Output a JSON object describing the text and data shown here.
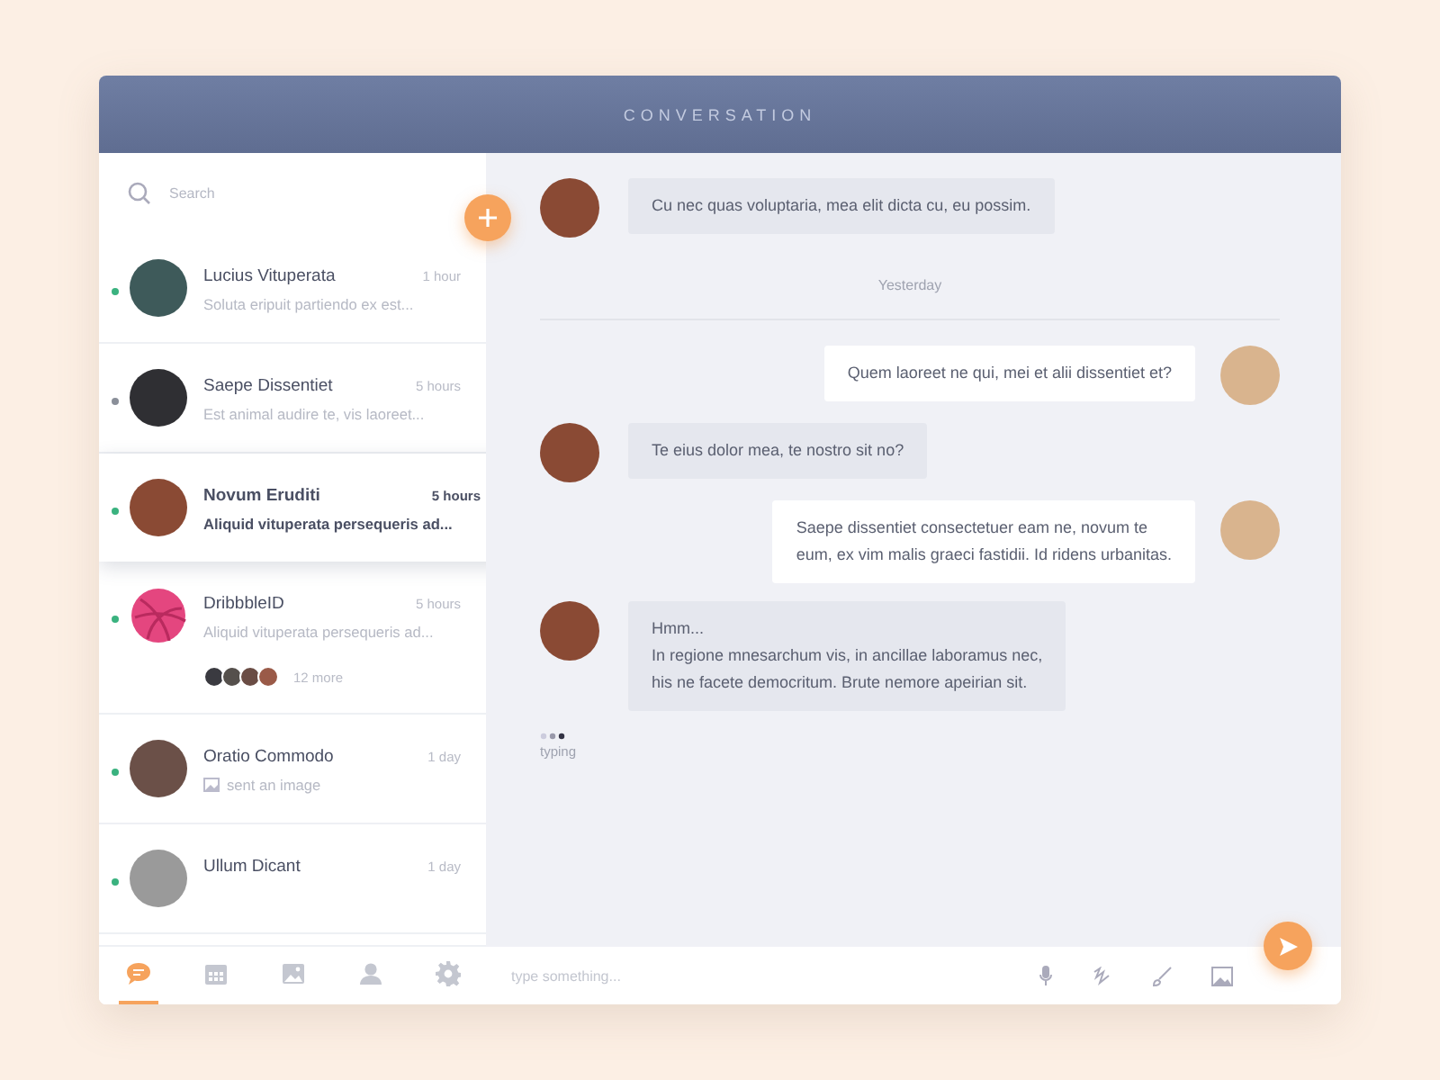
{
  "header": {
    "title": "CONVERSATION"
  },
  "search": {
    "placeholder": "Search"
  },
  "contacts": [
    {
      "name": "Lucius Vituperata",
      "time": "1 hour",
      "preview": "Soluta eripuit partiendo ex est...",
      "online": true,
      "selected": false,
      "kind": "person",
      "color": "#3e5a5a"
    },
    {
      "name": "Saepe Dissentiet",
      "time": "5 hours",
      "preview": "Est animal audire te, vis laoreet...",
      "online": false,
      "selected": false,
      "kind": "person",
      "color": "#2f2f33"
    },
    {
      "name": "Novum Eruditi",
      "time": "5 hours",
      "preview": "Aliquid vituperata persequeris ad...",
      "online": true,
      "selected": true,
      "kind": "person",
      "color": "#8a4a34"
    },
    {
      "name": "DribbbleID",
      "time": "5 hours",
      "preview": "Aliquid vituperata persequeris ad...",
      "online": true,
      "selected": false,
      "kind": "group",
      "color": "#e4467f",
      "more": "12 more"
    },
    {
      "name": "Oratio Commodo",
      "time": "1 day",
      "preview": "sent an image",
      "online": true,
      "selected": false,
      "kind": "image",
      "color": "#6b5048"
    },
    {
      "name": "Ullum Dicant",
      "time": "1 day",
      "online": true,
      "selected": false,
      "kind": "person",
      "color": "#9a9a9a"
    }
  ],
  "tabs": [
    {
      "selected": true
    },
    {
      "selected": false
    },
    {
      "selected": false
    },
    {
      "selected": false
    },
    {
      "selected": false
    }
  ],
  "messages": [
    {
      "kind": "them",
      "lines": [
        "Cu nec quas voluptaria, mea elit dicta cu, eu possim."
      ]
    },
    {
      "kind": "date",
      "lines": [
        "Yesterday"
      ]
    },
    {
      "kind": "me",
      "lines": [
        "Quem laoreet ne qui, mei et alii dissentiet et?"
      ]
    },
    {
      "kind": "them",
      "lines": [
        "Te eius dolor mea, te nostro sit no?"
      ]
    },
    {
      "kind": "me",
      "lines": [
        "Saepe dissentiet consectetuer eam ne, novum te",
        "eum, ex vim malis graeci fastidii. Id ridens urbanitas."
      ]
    },
    {
      "kind": "them",
      "lines": [
        "Hmm...",
        "In regione mnesarchum vis, in ancillae laboramus nec,",
        "his ne facete democritum. Brute nemore apeirian sit."
      ]
    }
  ],
  "typing": {
    "label": "typing"
  },
  "composer": {
    "placeholder": "type something..."
  }
}
